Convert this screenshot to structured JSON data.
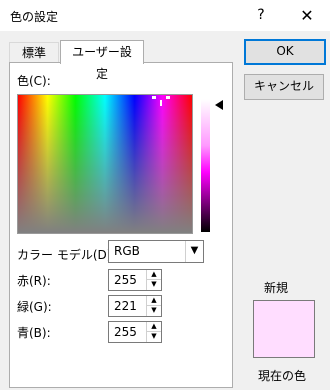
{
  "window": {
    "title": "色の設定",
    "help": "?",
    "close": "✕"
  },
  "tabs": [
    {
      "label": "標準"
    },
    {
      "label": "ユーザー設定"
    }
  ],
  "color": {
    "label": "色(C):"
  },
  "model": {
    "label": "カラー モデル(D):",
    "value": "RGB"
  },
  "fields": [
    {
      "label": "赤(R):",
      "value": "255"
    },
    {
      "label": "緑(G):",
      "value": "221"
    },
    {
      "label": "青(B):",
      "value": "255"
    }
  ],
  "buttons": {
    "ok": "OK",
    "cancel": "キャンセル"
  },
  "preview": {
    "new_label": "新規",
    "current_label": "現在の色",
    "new_color": "#ffddff"
  }
}
